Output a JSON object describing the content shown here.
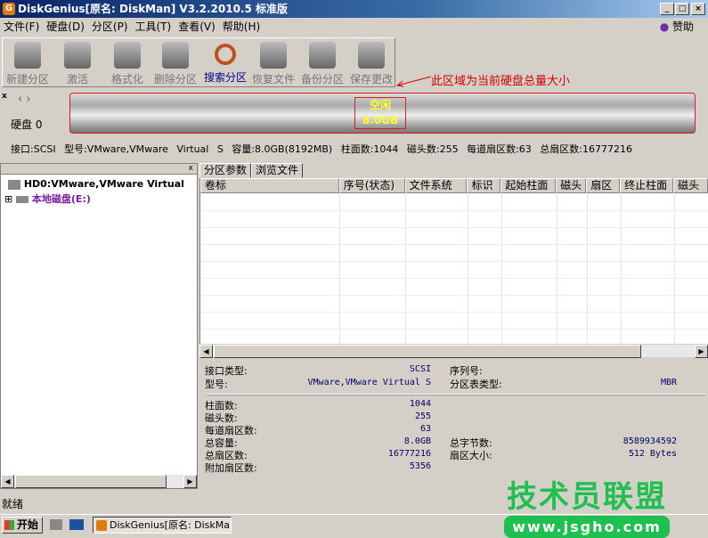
{
  "window": {
    "title": "DiskGenius[原名: DiskMan] V3.2.2010.5 标准版",
    "min": "_",
    "max": "□",
    "close": "×"
  },
  "menu": [
    "文件(F)",
    "硬盘(D)",
    "分区(P)",
    "工具(T)",
    "查看(V)",
    "帮助(H)"
  ],
  "sponsor": "赞助",
  "toolbar": [
    {
      "label": "新建分区",
      "icon": "new-partition-icon"
    },
    {
      "label": "激活",
      "icon": "activate-icon"
    },
    {
      "label": "格式化",
      "icon": "format-icon"
    },
    {
      "label": "删除分区",
      "icon": "delete-icon"
    },
    {
      "label": "搜索分区",
      "icon": "search-icon",
      "active": true
    },
    {
      "label": "恢复文件",
      "icon": "recover-icon"
    },
    {
      "label": "备份分区",
      "icon": "backup-icon"
    },
    {
      "label": "保存更改",
      "icon": "save-icon"
    }
  ],
  "annotation": "此区域为当前硬盘总量大小",
  "disk": {
    "label": "硬盘 0",
    "free_label": "空闲",
    "free_size": "8.0GB",
    "info": "接口:SCSI  型号:VMware,VMware Virtual S  容量:8.0GB(8192MB)  柱面数:1044  磁头数:255  每道扇区数:63  总扇区数:16777216"
  },
  "tree": {
    "disk": "HD0:VMware,VMware Virtual",
    "volume": "本地磁盘(E:)"
  },
  "tabs": [
    "分区参数",
    "浏览文件"
  ],
  "columns": [
    "卷标",
    "序号(状态)",
    "文件系统",
    "标识",
    "起始柱面",
    "磁头",
    "扇区",
    "终止柱面",
    "磁头"
  ],
  "details": {
    "rows_left": [
      [
        "接口类型:",
        "SCSI"
      ],
      [
        "型号:",
        "VMware,VMware Virtual S"
      ],
      [
        "柱面数:",
        "1044"
      ],
      [
        "磁头数:",
        "255"
      ],
      [
        "每道扇区数:",
        "63"
      ],
      [
        "总容量:",
        "8.0GB"
      ],
      [
        "总扇区数:",
        "16777216"
      ],
      [
        "附加扇区数:",
        "5356"
      ]
    ],
    "rows_right": [
      [
        "序列号:",
        ""
      ],
      [
        "分区表类型:",
        "MBR"
      ],
      [
        "总字节数:",
        "8589934592"
      ],
      [
        "扇区大小:",
        "512 Bytes"
      ]
    ]
  },
  "status": "就绪",
  "taskbar": {
    "start": "开始",
    "task": "DiskGenius[原名: DiskMa..."
  },
  "watermark": {
    "text": "技术员联盟",
    "url": "www.jsgho.com"
  }
}
